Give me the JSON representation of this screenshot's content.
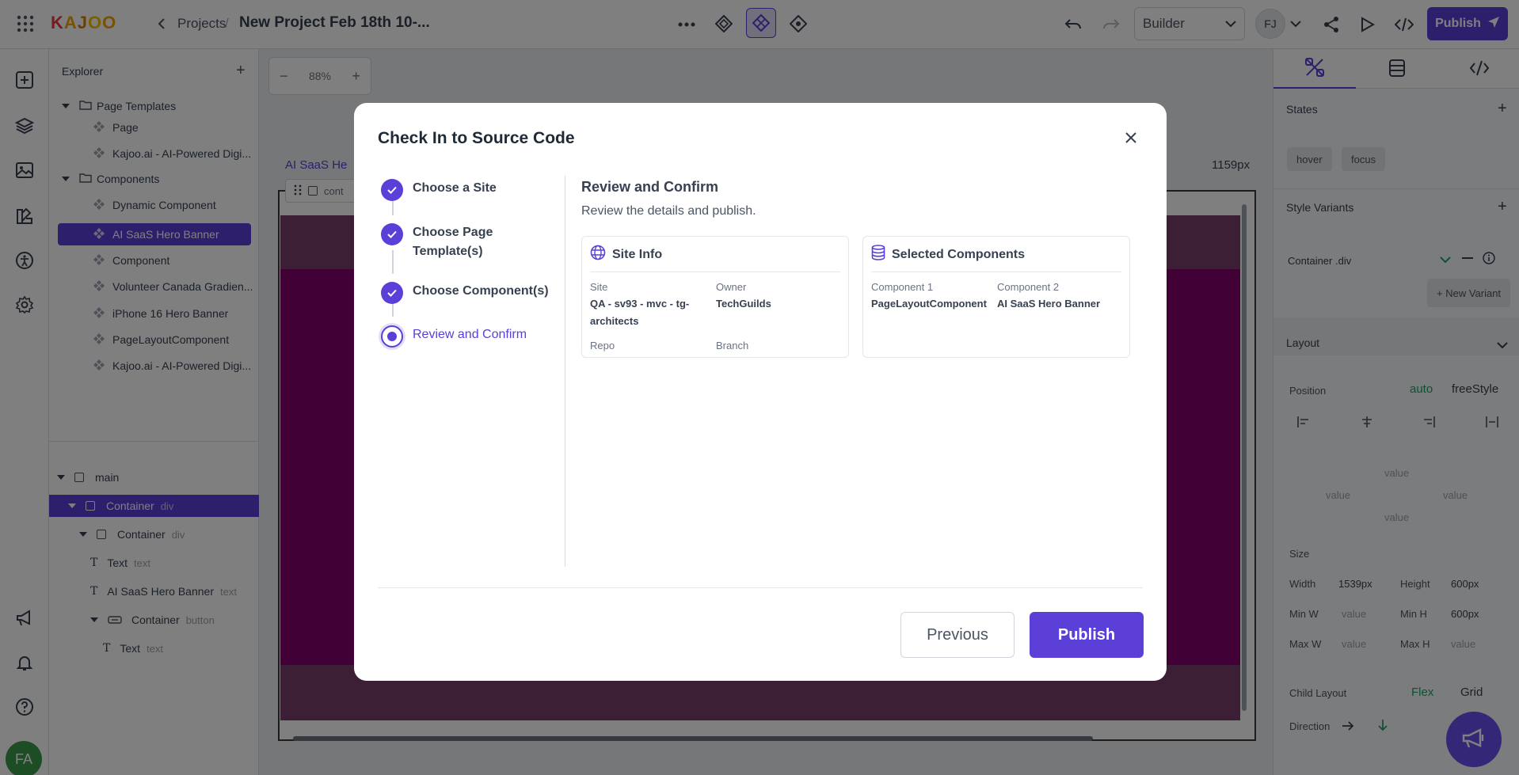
{
  "topbar": {
    "logo_letters": [
      "K",
      "A",
      "J",
      "O",
      "O"
    ],
    "breadcrumb_projects": "Projects",
    "breadcrumb_sep": "/",
    "project_title": "New Project Feb 18th 10-...",
    "mode_select": "Builder",
    "user_initials": "FJ",
    "publish_label": "Publish"
  },
  "explorer": {
    "title": "Explorer",
    "items": [
      {
        "label": "Page Templates"
      },
      {
        "label": "Page"
      },
      {
        "label": "Kajoo.ai - AI-Powered Digi..."
      },
      {
        "label": "Components"
      },
      {
        "label": "Dynamic Component"
      },
      {
        "label": "AI SaaS Hero Banner"
      },
      {
        "label": "Component"
      },
      {
        "label": "Volunteer Canada Gradien..."
      },
      {
        "label": "iPhone 16 Hero Banner"
      },
      {
        "label": "PageLayoutComponent"
      },
      {
        "label": "Kajoo.ai - AI-Powered Digi..."
      }
    ],
    "layers": [
      {
        "label": "main",
        "type": ""
      },
      {
        "label": "Container",
        "type": "div"
      },
      {
        "label": "Container",
        "type": "div"
      },
      {
        "label": "Text",
        "type": "text"
      },
      {
        "label": "AI SaaS Hero Banner",
        "type": "text"
      },
      {
        "label": "Container",
        "type": "button"
      },
      {
        "label": "Text",
        "type": "text"
      }
    ]
  },
  "canvas": {
    "zoom": "88%",
    "frame_label": "AI SaaS He",
    "width_readout": "1159px",
    "toolbar_label": "cont"
  },
  "user_avatar": "FA",
  "rpanel": {
    "states_title": "States",
    "state_chips": [
      "hover",
      "focus"
    ],
    "style_variants_title": "Style Variants",
    "variant_name": "Container .div",
    "new_variant": "+ New Variant",
    "layout_title": "Layout",
    "position_label": "Position",
    "position_auto": "auto",
    "position_free": "freeStyle",
    "value_placeholder": "value",
    "size_title": "Size",
    "width_label": "Width",
    "width_value": "1539px",
    "height_label": "Height",
    "height_value": "600px",
    "minw_label": "Min W",
    "minh_label": "Min H",
    "minh_value": "600px",
    "maxw_label": "Max W",
    "maxh_label": "Max H",
    "child_layout_label": "Child Layout",
    "child_flex": "Flex",
    "child_grid": "Grid",
    "direction_label": "Direction"
  },
  "modal": {
    "title": "Check In to Source Code",
    "steps": [
      {
        "label": "Choose a Site"
      },
      {
        "label": "Choose Page Template(s)"
      },
      {
        "label": "Choose Component(s)"
      },
      {
        "label": "Review and Confirm"
      }
    ],
    "content_title": "Review and Confirm",
    "content_subtitle": "Review the details and publish.",
    "site_info": {
      "title": "Site Info",
      "site_label": "Site",
      "site_value": "QA - sv93 - mvc - tg-architects",
      "owner_label": "Owner",
      "owner_value": "TechGuilds",
      "repo_label": "Repo",
      "branch_label": "Branch"
    },
    "selected_components": {
      "title": "Selected Components",
      "c1_label": "Component 1",
      "c1_value": "PageLayoutComponent",
      "c2_label": "Component 2",
      "c2_value": "AI SaaS Hero Banner"
    },
    "previous_label": "Previous",
    "publish_label": "Publish"
  },
  "colors": {
    "accent": "#5b3fd6",
    "canvas_main": "#82006c",
    "avatar_green": "#3a9a4a"
  }
}
